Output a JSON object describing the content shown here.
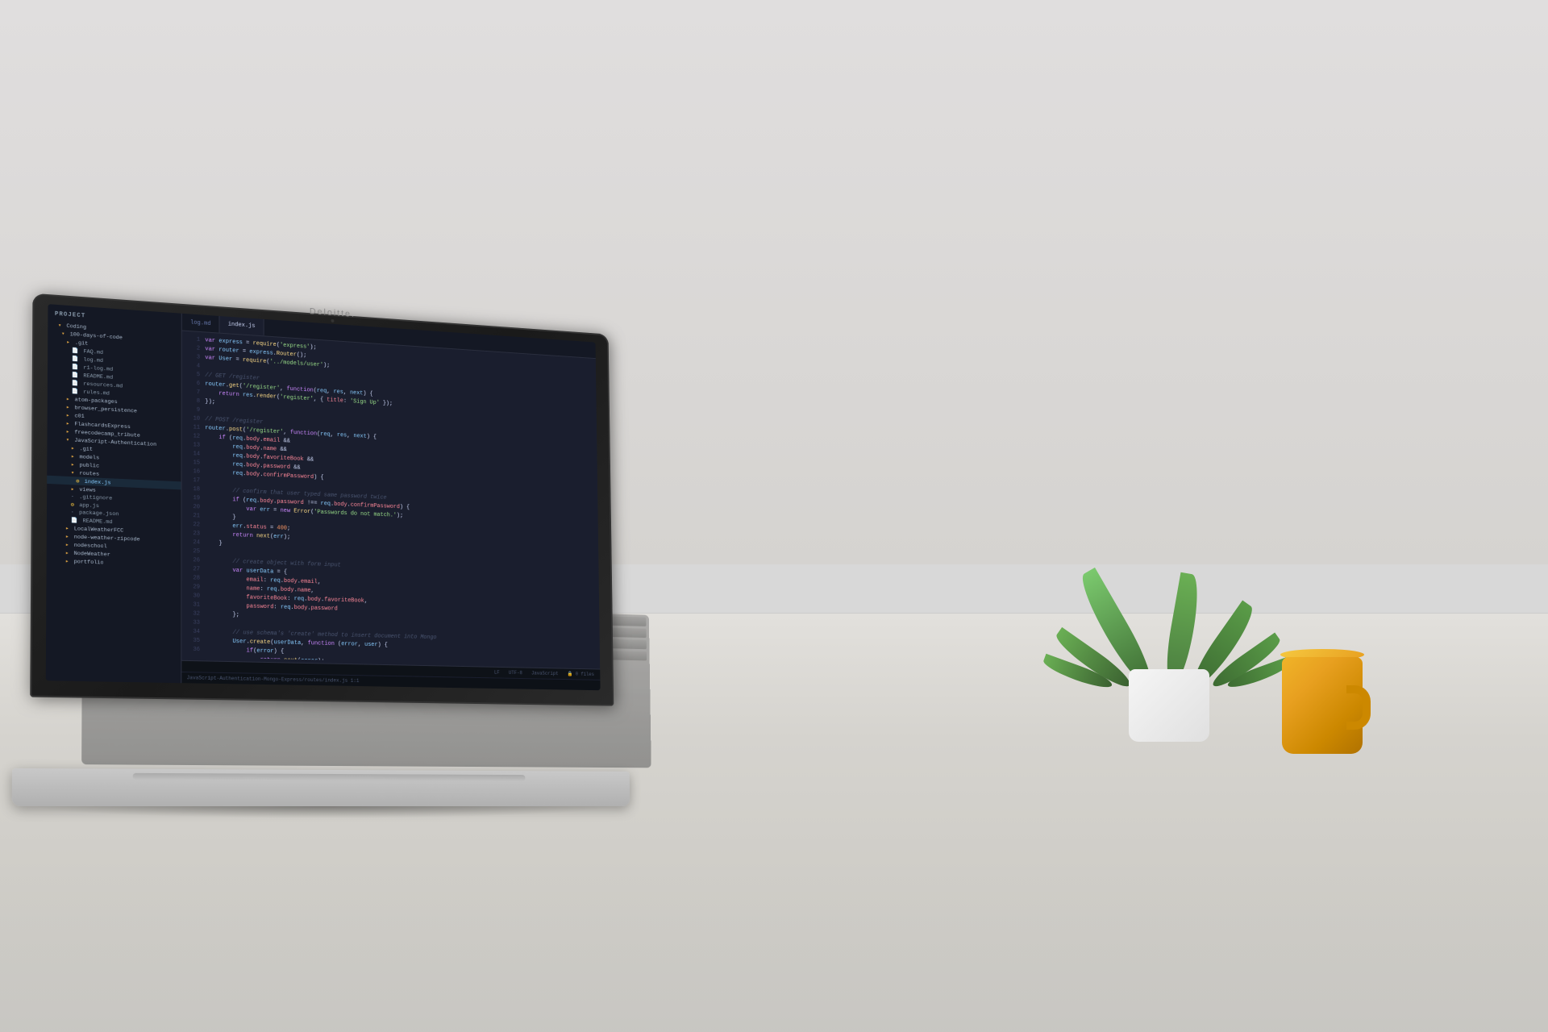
{
  "scene": {
    "laptop_brand": "Deloitte.",
    "status_bar": {
      "encoding": "LF",
      "charset": "UTF-8",
      "language": "JavaScript",
      "files": "0 files"
    },
    "bottom_bar": {
      "path": "JavaScript-Authentication-Mongo-Express/routes/index.js  1:1"
    },
    "tabs": [
      {
        "label": "log.md",
        "active": false
      },
      {
        "label": "index.js",
        "active": true
      }
    ],
    "sidebar": {
      "title": "Project",
      "items": [
        {
          "label": "▾ Coding",
          "level": 0,
          "type": "folder"
        },
        {
          "label": "▾ 100-days-of-code",
          "level": 1,
          "type": "folder"
        },
        {
          "label": "▾ .git",
          "level": 2,
          "type": "folder"
        },
        {
          "label": "FAQ.md",
          "level": 3,
          "type": "md"
        },
        {
          "label": "log.md",
          "level": 3,
          "type": "md"
        },
        {
          "label": "r1-log.md",
          "level": 3,
          "type": "md"
        },
        {
          "label": "README.md",
          "level": 3,
          "type": "md"
        },
        {
          "label": "resources.md",
          "level": 3,
          "type": "md"
        },
        {
          "label": "rules.md",
          "level": 3,
          "type": "md"
        },
        {
          "label": "▸ atom-packages",
          "level": 2,
          "type": "folder"
        },
        {
          "label": "▸ browser_persistence",
          "level": 2,
          "type": "folder"
        },
        {
          "label": "▸ c01",
          "level": 2,
          "type": "folder"
        },
        {
          "label": "▸ FlashcardsExpress",
          "level": 2,
          "type": "folder"
        },
        {
          "label": "▸ freecodecamp_tribute",
          "level": 2,
          "type": "folder"
        },
        {
          "label": "▾ JavaScript-Authentication",
          "level": 2,
          "type": "folder"
        },
        {
          "label": "▸ .git",
          "level": 3,
          "type": "folder"
        },
        {
          "label": "▸ models",
          "level": 3,
          "type": "folder"
        },
        {
          "label": "▸ public",
          "level": 3,
          "type": "folder"
        },
        {
          "label": "▾ routes",
          "level": 3,
          "type": "folder"
        },
        {
          "label": "index.js",
          "level": 4,
          "type": "js",
          "active": true
        },
        {
          "label": "▸ views",
          "level": 3,
          "type": "folder"
        },
        {
          "label": ".gitignore",
          "level": 3,
          "type": "file"
        },
        {
          "label": "app.js",
          "level": 3,
          "type": "js"
        },
        {
          "label": "package.json",
          "level": 3,
          "type": "file"
        },
        {
          "label": "README.md",
          "level": 3,
          "type": "md"
        },
        {
          "label": "▸ LocalWeatherFCC",
          "level": 2,
          "type": "folder"
        },
        {
          "label": "▸ node-weather-zipcode",
          "level": 2,
          "type": "folder"
        },
        {
          "label": "▸ nodeschool",
          "level": 2,
          "type": "folder"
        },
        {
          "label": "▸ NodeWeather",
          "level": 2,
          "type": "folder"
        },
        {
          "label": "▸ portfolio",
          "level": 2,
          "type": "folder"
        }
      ]
    },
    "code_lines": [
      "var express = require('express');",
      "var router = express.Router();",
      "var User = require('../models/user');",
      "",
      "// GET /register",
      "router.get('/register', function(req, res, next) {",
      "    return res.render('register', { title: 'Sign Up' });",
      "});",
      "",
      "// POST /register",
      "router.post('/register', function(req, res, next) {",
      "    if (req.body.email &&",
      "        req.body.name &&",
      "        req.body.favoriteBook &&",
      "        req.body.password &&",
      "        req.body.confirmPassword) {",
      "",
      "        // confirm that user typed same password twice",
      "        if (req.body.password !== req.body.confirmPassword) {",
      "            var err = new Error('Passwords do not match.');",
      "        }",
      "        err.status = 400;",
      "        return next(err);",
      "    }",
      "",
      "        // create object with form input",
      "        var userData = {",
      "            email: req.body.email,",
      "            name: req.body.name,",
      "            favoriteBook: req.body.favoriteBook,",
      "            password: req.body.password",
      "        };",
      "",
      "        // use schema's 'create' method to insert document into Mongo",
      "        User.create(userData, function (error, user) {",
      "            if(error) {",
      "                return next(error);"
    ]
  }
}
